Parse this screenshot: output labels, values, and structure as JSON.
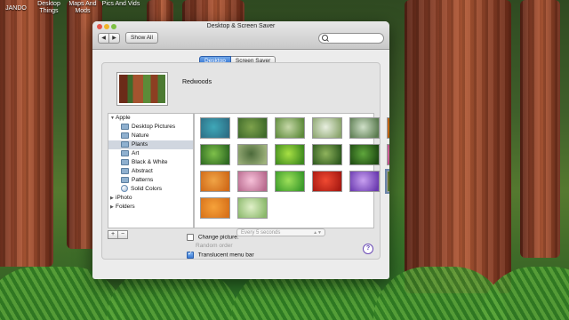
{
  "desktop": {
    "icons": [
      {
        "label": "JANDO"
      },
      {
        "label": "Desktop Things"
      },
      {
        "label": "Maps And Mods"
      },
      {
        "label": "Pics And Vids"
      }
    ]
  },
  "window": {
    "title": "Desktop & Screen Saver",
    "show_all": "Show All",
    "search_placeholder": "",
    "tabs": [
      {
        "label": "Desktop",
        "selected": true
      },
      {
        "label": "Screen Saver",
        "selected": false
      }
    ],
    "current_picture": "Redwoods",
    "sources": [
      {
        "label": "Apple",
        "type": "group",
        "disclosure": "▼"
      },
      {
        "label": "Desktop Pictures",
        "type": "folder"
      },
      {
        "label": "Nature",
        "type": "folder"
      },
      {
        "label": "Plants",
        "type": "folder",
        "selected": true
      },
      {
        "label": "Art",
        "type": "folder"
      },
      {
        "label": "Black & White",
        "type": "folder"
      },
      {
        "label": "Abstract",
        "type": "folder"
      },
      {
        "label": "Patterns",
        "type": "folder"
      },
      {
        "label": "Solid Colors",
        "type": "color"
      },
      {
        "label": "iPhoto",
        "type": "group",
        "disclosure": "▶"
      },
      {
        "label": "Folders",
        "type": "group",
        "disclosure": "▶"
      }
    ],
    "thumbnails": [
      {
        "color_a": "#3fa8b8",
        "color_b": "#2d6f86"
      },
      {
        "color_a": "#7ea24c",
        "color_b": "#3f6a2a"
      },
      {
        "color_a": "#c6d8a8",
        "color_b": "#5d8a3a"
      },
      {
        "color_a": "#e8efe0",
        "color_b": "#8aa46c"
      },
      {
        "color_a": "#cfe0c8",
        "color_b": "#5a7b4f"
      },
      {
        "color_a": "#f08a2a",
        "color_b": "#b45a10"
      },
      {
        "color_a": "#7ec04a",
        "color_b": "#2f6a22"
      },
      {
        "color_a": "#4c6a3a",
        "color_b": "#9eb27c"
      },
      {
        "color_a": "#a8e044",
        "color_b": "#3e8a1e"
      },
      {
        "color_a": "#8fb35c",
        "color_b": "#2f5a1f"
      },
      {
        "color_a": "#5fa63c",
        "color_b": "#1e4a12"
      },
      {
        "color_a": "#f2a2c8",
        "color_b": "#c24a8a"
      },
      {
        "color_a": "#f0a446",
        "color_b": "#d06a18"
      },
      {
        "color_a": "#f6c0d8",
        "color_b": "#b86a8e"
      },
      {
        "color_a": "#9ee05a",
        "color_b": "#3a9a2a"
      },
      {
        "color_a": "#f04a32",
        "color_b": "#a81a12"
      },
      {
        "color_a": "#c8a0f0",
        "color_b": "#6a3ab0"
      },
      {
        "color_a": "#a6532f",
        "color_b": "#4b7a31",
        "selected": true
      },
      {
        "color_a": "#f6a23a",
        "color_b": "#d8721a"
      },
      {
        "color_a": "#e0f0c8",
        "color_b": "#8ab86a"
      }
    ],
    "change_picture_label": "Change picture:",
    "change_picture_checked": false,
    "interval_value": "Every 5 seconds",
    "random_order_label": "Random order",
    "translucent_label": "Translucent menu bar",
    "translucent_checked": true,
    "add_label": "+",
    "remove_label": "−",
    "help_label": "?"
  }
}
